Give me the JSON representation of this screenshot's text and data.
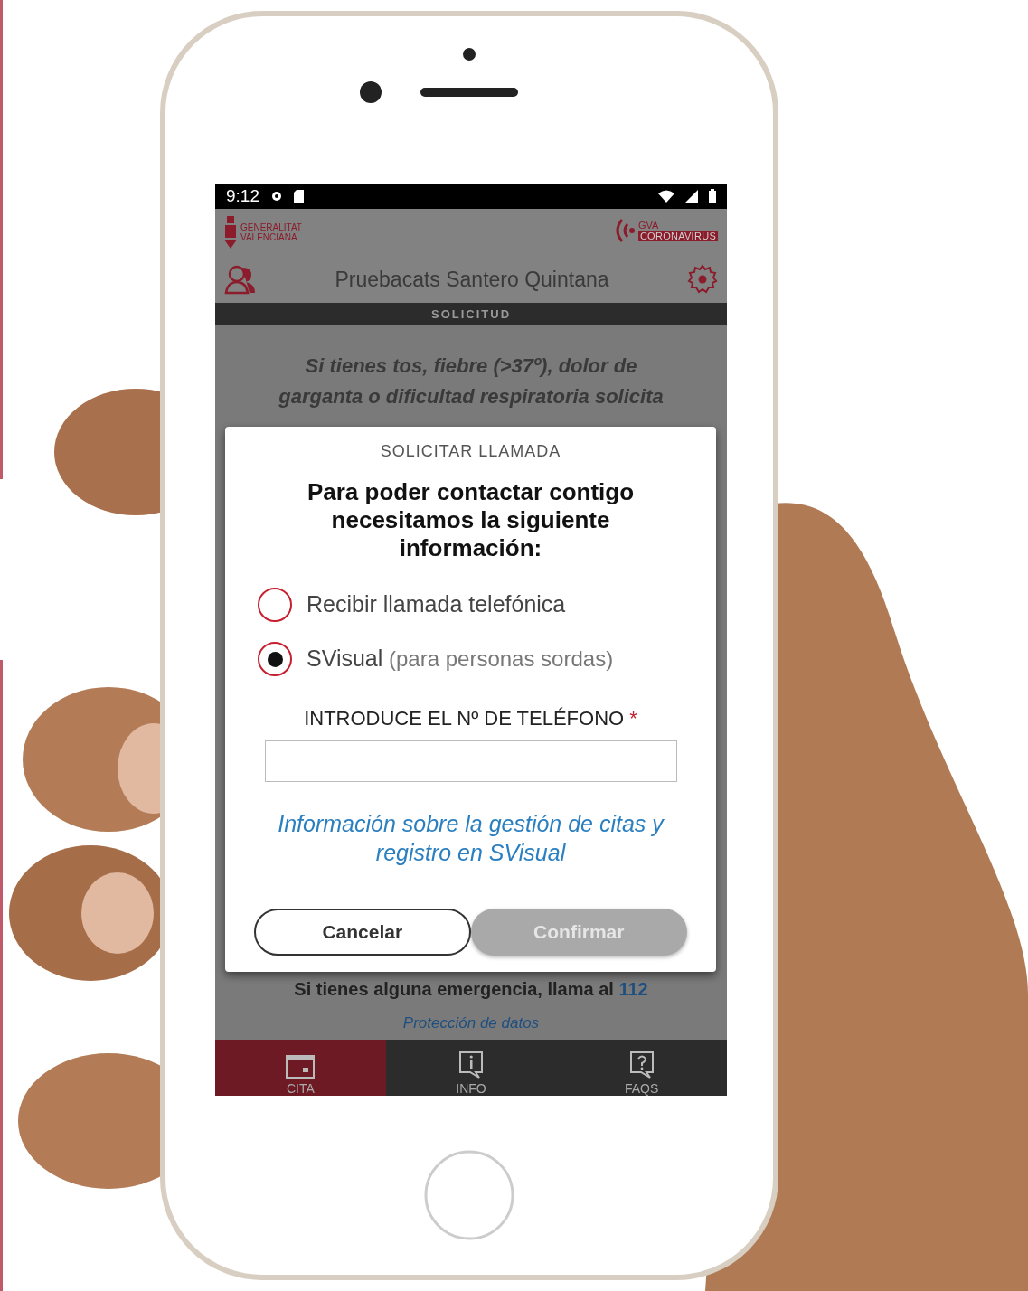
{
  "status_bar": {
    "time": "9:12"
  },
  "header": {
    "logo_left": [
      "GENERALITAT",
      "VALENCIANA"
    ],
    "logo_right": {
      "top": "GVA",
      "badge": "CORONAVIRUS"
    },
    "user_name": "Pruebacats Santero Quintana"
  },
  "section_bar": "SOLICITUD",
  "notice": [
    "Si tienes tos, fiebre (>37º), dolor de",
    "garganta o dificultad respiratoria solicita"
  ],
  "dialog": {
    "title": "SOLICITAR LLAMADA",
    "heading": "Para poder contactar contigo necesitamos la siguiente información:",
    "options": [
      {
        "label": "Recibir llamada telefónica",
        "selected": false
      },
      {
        "label": "SVisual",
        "note": "(para personas sordas)",
        "selected": true
      }
    ],
    "phone_field": {
      "label": "INTRODUCE EL Nº DE TELÉFONO",
      "required_mark": "*"
    },
    "info_link": "Información sobre la gestión de citas y registro en SVisual",
    "buttons": [
      {
        "label": "Cancelar",
        "kind": "secondary",
        "disabled": false
      },
      {
        "label": "Confirmar",
        "kind": "primary",
        "disabled": true
      }
    ]
  },
  "emergency": {
    "text": "Si tienes alguna emergencia, llama al",
    "number": "112"
  },
  "privacy_link": "Protección de datos",
  "tabs": [
    {
      "label": "CITA",
      "kind": "calendar",
      "selected": true
    },
    {
      "label": "INFO",
      "kind": "info",
      "selected": false
    },
    {
      "label": "FAQS",
      "kind": "question",
      "selected": false
    }
  ]
}
